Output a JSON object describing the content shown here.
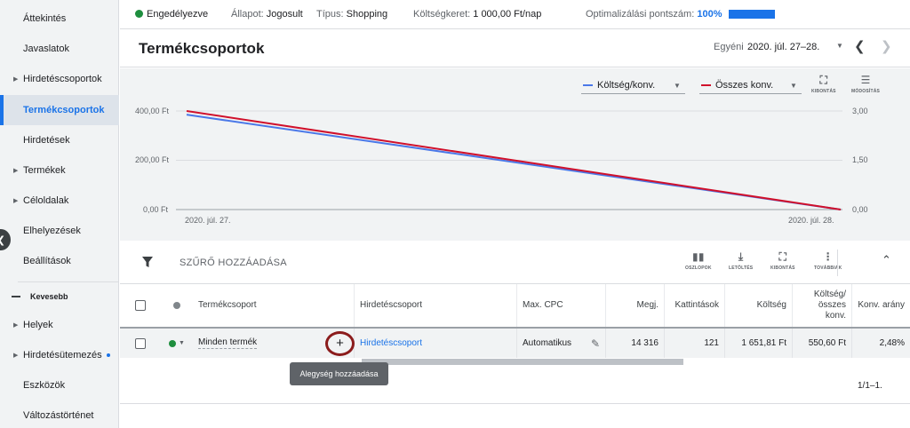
{
  "sidebar": {
    "items": [
      {
        "label": "Áttekintés",
        "caret": false
      },
      {
        "label": "Javaslatok",
        "caret": false
      },
      {
        "label": "Hirdetéscsoportok",
        "caret": true
      },
      {
        "label": "Termékcsoportok",
        "caret": false,
        "active": true
      },
      {
        "label": "Hirdetések",
        "caret": false
      },
      {
        "label": "Termékek",
        "caret": true
      },
      {
        "label": "Céloldalak",
        "caret": true
      },
      {
        "label": "Elhelyezések",
        "caret": false
      },
      {
        "label": "Beállítások",
        "caret": false
      }
    ],
    "less_label": "Kevesebb",
    "more_items": [
      {
        "label": "Helyek",
        "caret": true
      },
      {
        "label": "Hirdetésütemezés",
        "caret": true,
        "dot": true
      },
      {
        "label": "Eszközök",
        "caret": false
      },
      {
        "label": "Változástörténet",
        "caret": false
      }
    ]
  },
  "status": {
    "enabled": "Engedélyezve",
    "state_label": "Állapot:",
    "state_value": "Jogosult",
    "type_label": "Típus:",
    "type_value": "Shopping",
    "budget_label": "Költségkeret:",
    "budget_value": "1 000,00 Ft/nap",
    "opt_label": "Optimalizálási pontszám:",
    "opt_value": "100%",
    "opt_fraction": 1.0
  },
  "header": {
    "title": "Termékcsoportok",
    "date_label": "Egyéni",
    "date_value": "2020. júl. 27–28."
  },
  "chart_toolbar": {
    "metric1": "Költség/konv.",
    "metric2": "Összes konv.",
    "expand_label": "KIBONTÁS",
    "modify_label": "MÓDOSÍTÁS"
  },
  "colors": {
    "metric1": "#4a78e8",
    "metric2": "#d0102b",
    "accent": "#1a73e8"
  },
  "chart_data": {
    "type": "line",
    "x": [
      "2020. júl. 27.",
      "2020. júl. 28."
    ],
    "series": [
      {
        "name": "Költség/konv.",
        "values": [
          385,
          0
        ],
        "axis": "left"
      },
      {
        "name": "Összes konv.",
        "values": [
          3,
          0
        ],
        "axis": "right"
      }
    ],
    "y_left_ticks": [
      "400,00 Ft",
      "200,00 Ft",
      "0,00 Ft"
    ],
    "y_right_ticks": [
      "3,00",
      "1,50",
      "0,00"
    ],
    "y_left_lim": [
      0,
      400
    ],
    "y_right_lim": [
      0,
      3
    ],
    "grid": true
  },
  "table_toolbar": {
    "filter_label": "SZŰRŐ HOZZÁADÁSA",
    "columns_label": "OSZLOPOK",
    "download_label": "LETÖLTÉS",
    "expand_label": "KIBONTÁS",
    "more_label": "TOVÁBBIAK"
  },
  "table": {
    "headers": {
      "group": "Termékcsoport",
      "adgroup": "Hirdetéscsoport",
      "cpc": "Max. CPC",
      "impr": "Megj.",
      "clicks": "Kattintások",
      "cost": "Költség",
      "cost_conv": "Költség/ összes konv.",
      "conv_rate": "Konv. arány"
    },
    "row": {
      "group": "Minden termék",
      "adgroup": "Hirdetéscsoport",
      "cpc": "Automatikus",
      "impr": "14 316",
      "clicks": "121",
      "cost": "1 651,81 Ft",
      "cost_conv": "550,60 Ft",
      "conv_rate": "2,48%"
    },
    "tooltip": "Alegység hozzáadása",
    "pager": "1/1–1."
  }
}
